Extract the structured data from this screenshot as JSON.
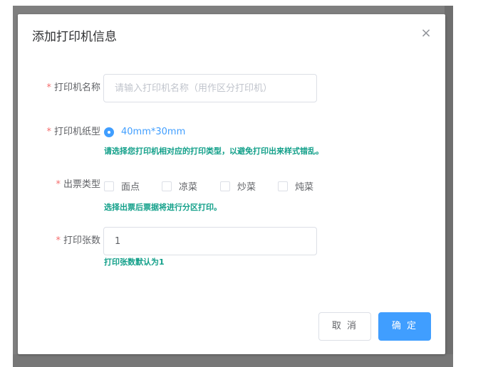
{
  "dialog": {
    "title": "添加打印机信息",
    "close_icon": "×"
  },
  "form": {
    "required_mark": "*",
    "printer_name": {
      "label": "打印机名称",
      "placeholder": "请输入打印机名称（用作区分打印机）",
      "value": ""
    },
    "paper_type": {
      "label": "打印机纸型",
      "selected_option": "40mm*30mm",
      "hint": "请选择您打印机相对应的打印类型，以避免打印出来样式错乱。"
    },
    "ticket_type": {
      "label": "出票类型",
      "options": [
        "面点",
        "凉菜",
        "炒菜",
        "炖菜"
      ],
      "hint": "选择出票后票据将进行分区打印。"
    },
    "copies": {
      "label": "打印张数",
      "value": "1",
      "hint": "打印张数默认为1"
    }
  },
  "footer": {
    "cancel_label": "取 消",
    "confirm_label": "确 定"
  },
  "colors": {
    "primary": "#409eff",
    "required": "#f56c6c",
    "hint": "#13a08a"
  }
}
